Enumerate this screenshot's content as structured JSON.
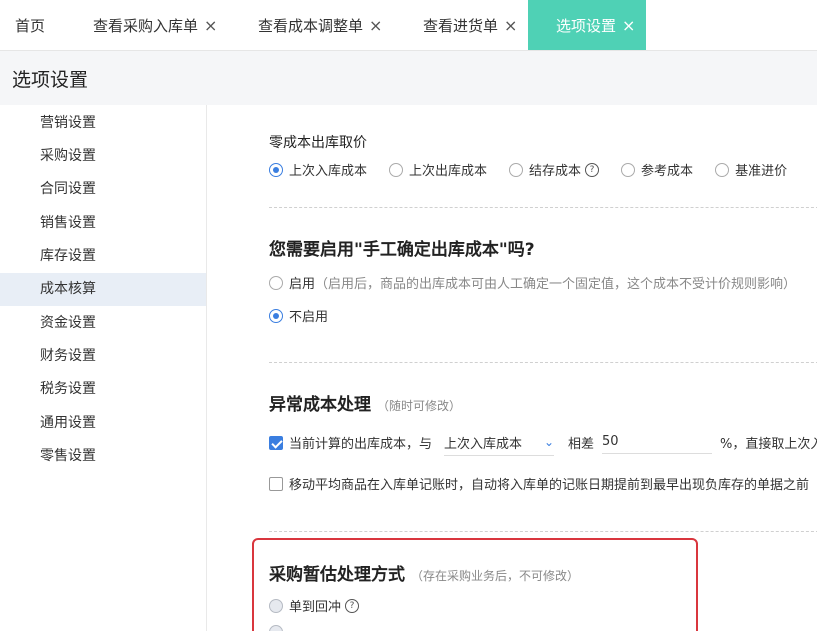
{
  "tabs": [
    {
      "label": "首页",
      "closable": false
    },
    {
      "label": "查看采购入库单",
      "closable": true
    },
    {
      "label": "查看成本调整单",
      "closable": true
    },
    {
      "label": "查看进货单",
      "closable": true
    },
    {
      "label": "选项设置",
      "closable": true,
      "active": true
    }
  ],
  "close_glyph": "×",
  "page_title": "选项设置",
  "sidebar": {
    "items": [
      {
        "label": "营销设置"
      },
      {
        "label": "采购设置"
      },
      {
        "label": "合同设置"
      },
      {
        "label": "销售设置"
      },
      {
        "label": "库存设置"
      },
      {
        "label": "成本核算",
        "active": true
      },
      {
        "label": "资金设置"
      },
      {
        "label": "财务设置"
      },
      {
        "label": "税务设置"
      },
      {
        "label": "通用设置"
      },
      {
        "label": "零售设置"
      }
    ]
  },
  "zero_cost": {
    "title": "零成本出库取价",
    "options": [
      "上次入库成本",
      "上次出库成本",
      "结存成本",
      "参考成本",
      "基准进价"
    ],
    "selected_index": 0,
    "help_icon_option_index": 2
  },
  "manual_cost": {
    "title": "您需要启用\"手工确定出库成本\"吗?",
    "enable_label": "启用",
    "enable_hint": "（启用后，商品的出库成本可由人工确定一个固定值，这个成本不受计价规则影响）",
    "disable_label": "不启用",
    "selected": "disable"
  },
  "abnormal_cost": {
    "title": "异常成本处理",
    "hint": "（随时可修改）",
    "rule1_prefix": "当前计算的出库成本，与",
    "rule1_select": "上次入库成本",
    "rule1_mid": "相差",
    "rule1_value": "50",
    "rule1_suffix": "%，直接取上次入库",
    "rule1_checked": true,
    "rule2_text": "移动平均商品在入库单记账时，自动将入库单的记账日期提前到最早出现负库存的单据之前",
    "rule2_checked": false
  },
  "purchase_estimate": {
    "title": "采购暂估处理方式",
    "hint": "（存在采购业务后，不可修改）",
    "option1": "单到回冲"
  },
  "colors": {
    "active_tab": "#4fd1b5",
    "primary": "#3a7ee0",
    "highlight_border": "#d9363e",
    "sidebar_active": "#e8eef6"
  }
}
